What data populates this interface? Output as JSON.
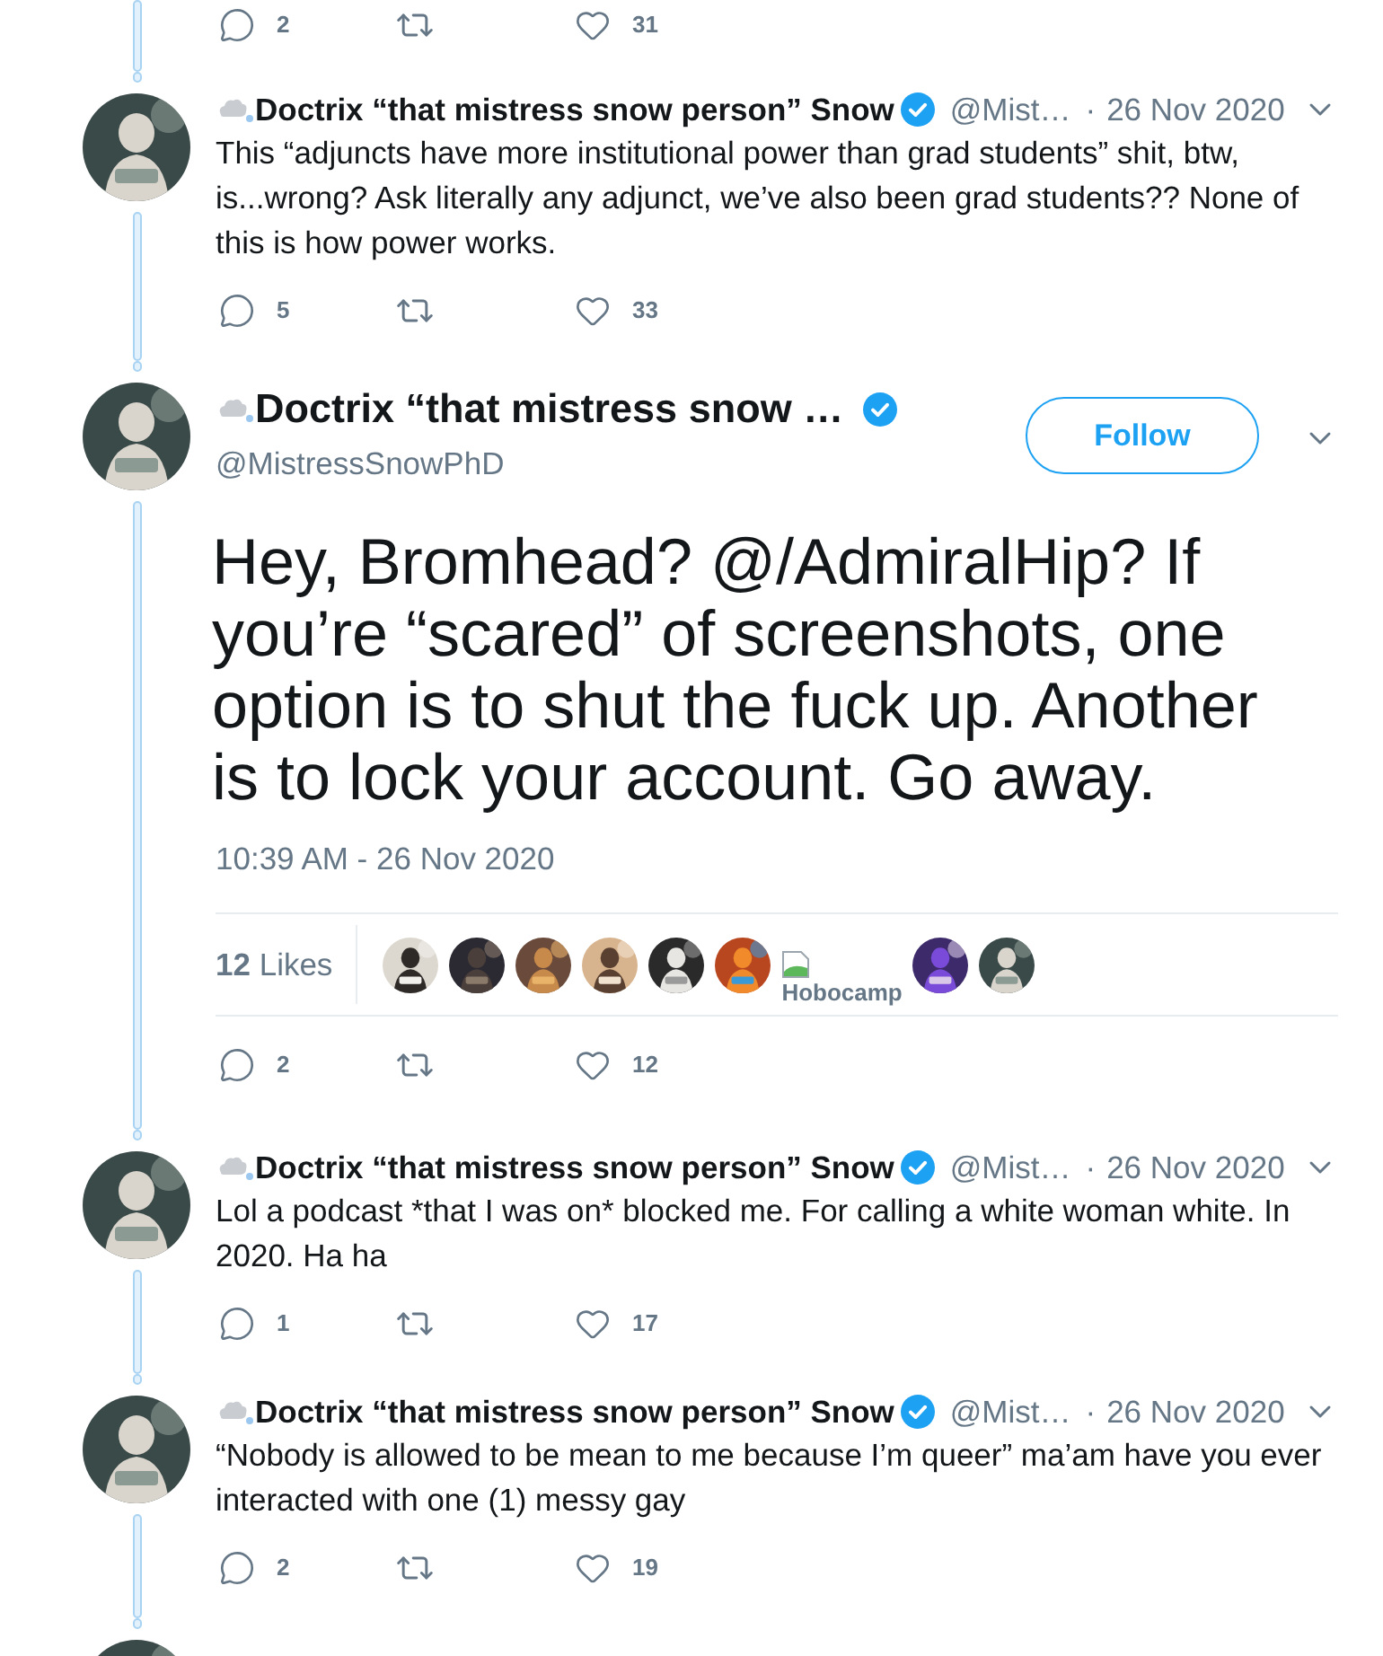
{
  "top_action_bar": {
    "replies": "2",
    "likes": "31"
  },
  "tweets": [
    {
      "kind": "compact",
      "name": "Doctrix “that mistress snow person” Snow",
      "verified": true,
      "handle": "@Mist…",
      "separator": "·",
      "date": "26 Nov 2020",
      "text": "This “adjuncts have more institutional power than grad students” shit, btw, is...wrong? Ask literally any adjunct, we’ve also been grad students?? None of this is how power works.",
      "replies": "5",
      "likes": "33"
    },
    {
      "kind": "focused",
      "name": "Doctrix “that mistress snow …",
      "verified": true,
      "handle": "@MistressSnowPhD",
      "follow_button": "Follow",
      "text": "Hey, Bromhead? @/AdmiralHip? If you’re “scared” of screenshots, one option is to shut the fuck up. Another is to lock your account. Go away.",
      "timestamp": "10:39 AM - 26 Nov 2020",
      "likes_summary": "**12** Likes",
      "likers": [
        {
          "kind": "picture"
        },
        {
          "kind": "picture"
        },
        {
          "kind": "picture"
        },
        {
          "kind": "picture"
        },
        {
          "kind": "picture"
        },
        {
          "kind": "picture"
        },
        {
          "kind": "broken",
          "alt": "Hobocamp"
        },
        {
          "kind": "picture"
        },
        {
          "kind": "picture"
        }
      ],
      "replies": "2",
      "likes": "12"
    },
    {
      "kind": "compact",
      "name": "Doctrix “that mistress snow person” Snow",
      "verified": true,
      "handle": "@Mist…",
      "separator": "·",
      "date": "26 Nov 2020",
      "text": "Lol a podcast *that I was on* blocked me. For calling a white woman white. In 2020. Ha ha",
      "replies": "1",
      "likes": "17"
    },
    {
      "kind": "compact",
      "name": "Doctrix “that mistress snow person” Snow",
      "verified": true,
      "handle": "@Mist…",
      "separator": "·",
      "date": "26 Nov 2020",
      "text": "“Nobody is allowed to be mean to me because I’m queer” ma’am have you ever interacted with one (1) messy gay",
      "replies": "2",
      "likes": "19"
    },
    {
      "kind": "partial"
    }
  ]
}
